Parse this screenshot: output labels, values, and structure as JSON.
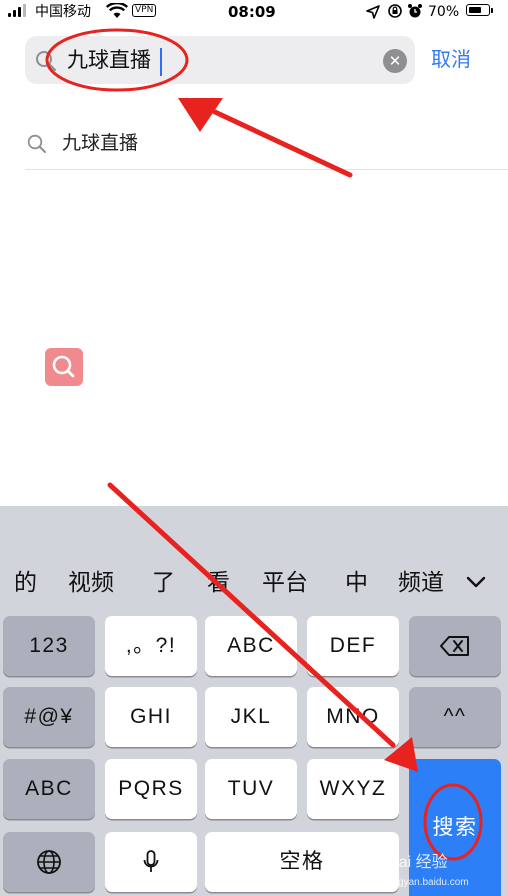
{
  "status_bar": {
    "carrier": "中国移动",
    "vpn": "VPN",
    "time": "08:09",
    "battery": "70%",
    "battery_level": 0.7
  },
  "search": {
    "query": "九球直播",
    "cancel_label": "取消",
    "clear_icon": "clear-x-icon"
  },
  "suggestions": [
    {
      "text": "九球直播"
    }
  ],
  "keyboard": {
    "candidates": [
      "的",
      "视频",
      "了",
      "看",
      "平台",
      "中",
      "频道"
    ],
    "rows": [
      [
        "123",
        ",。?!",
        "ABC",
        "DEF",
        "delete-icon"
      ],
      [
        "#@¥",
        "GHI",
        "JKL",
        "MNO",
        "^^"
      ],
      [
        "ABC",
        "PQRS",
        "TUV",
        "WXYZ"
      ],
      [
        "globe-icon",
        "mic-icon",
        "空格"
      ]
    ],
    "action_label": "搜索",
    "action_color": "#2c7ff6"
  },
  "watermark": {
    "brand": "Bai",
    "brand_suffix": "经验",
    "url": "jingyan.baidu.com"
  },
  "colors": {
    "accent": "#3478f6",
    "annotation": "#e8231f"
  }
}
